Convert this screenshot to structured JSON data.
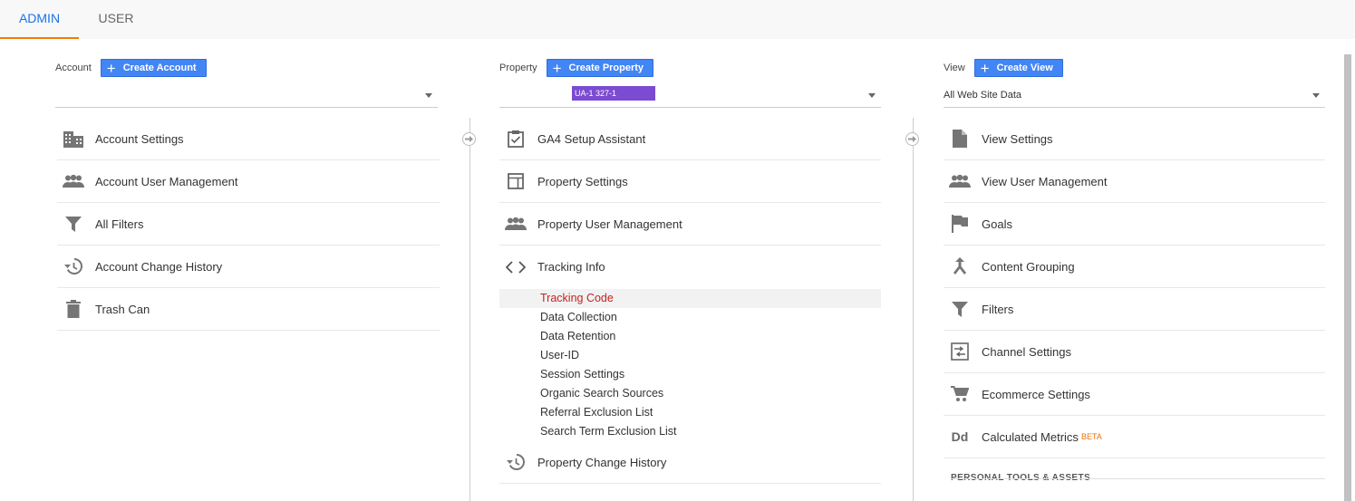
{
  "tabs": [
    {
      "label": "ADMIN",
      "active": true
    },
    {
      "label": "USER",
      "active": false
    }
  ],
  "account": {
    "label": "Account",
    "create_label": "Create Account",
    "selected": "",
    "items": [
      {
        "icon": "building-icon",
        "label": "Account Settings"
      },
      {
        "icon": "people-icon",
        "label": "Account User Management"
      },
      {
        "icon": "filter-icon",
        "label": "All Filters"
      },
      {
        "icon": "history-icon",
        "label": "Account Change History"
      },
      {
        "icon": "trash-icon",
        "label": "Trash Can"
      }
    ]
  },
  "property": {
    "label": "Property",
    "create_label": "Create Property",
    "selected": "UA-1        327-1",
    "items": [
      {
        "icon": "checklist-icon",
        "label": "GA4 Setup Assistant"
      },
      {
        "icon": "layout-icon",
        "label": "Property Settings"
      },
      {
        "icon": "people-icon",
        "label": "Property User Management"
      },
      {
        "icon": "code-icon",
        "label": "Tracking Info"
      }
    ],
    "tracking_subitems": [
      {
        "label": "Tracking Code",
        "active": true
      },
      {
        "label": "Data Collection",
        "active": false
      },
      {
        "label": "Data Retention",
        "active": false
      },
      {
        "label": "User-ID",
        "active": false
      },
      {
        "label": "Session Settings",
        "active": false
      },
      {
        "label": "Organic Search Sources",
        "active": false
      },
      {
        "label": "Referral Exclusion List",
        "active": false
      },
      {
        "label": "Search Term Exclusion List",
        "active": false
      }
    ],
    "after_items": [
      {
        "icon": "history-icon",
        "label": "Property Change History"
      }
    ]
  },
  "view": {
    "label": "View",
    "create_label": "Create View",
    "selected": "All Web Site Data",
    "items": [
      {
        "icon": "document-icon",
        "label": "View Settings"
      },
      {
        "icon": "people-icon",
        "label": "View User Management"
      },
      {
        "icon": "flag-icon",
        "label": "Goals"
      },
      {
        "icon": "merge-icon",
        "label": "Content Grouping"
      },
      {
        "icon": "filter-icon",
        "label": "Filters"
      },
      {
        "icon": "channel-icon",
        "label": "Channel Settings"
      },
      {
        "icon": "cart-icon",
        "label": "Ecommerce Settings"
      },
      {
        "icon": "dd-icon",
        "label": "Calculated Metrics",
        "badge": "BETA"
      }
    ],
    "personal_heading": "PERSONAL TOOLS & ASSETS"
  },
  "colors": {
    "accent_blue": "#4285f4",
    "active_tab": "#1a73e8",
    "tab_underline": "#f57c00",
    "active_subitem": "#c5221f",
    "beta": "#e8710a"
  }
}
